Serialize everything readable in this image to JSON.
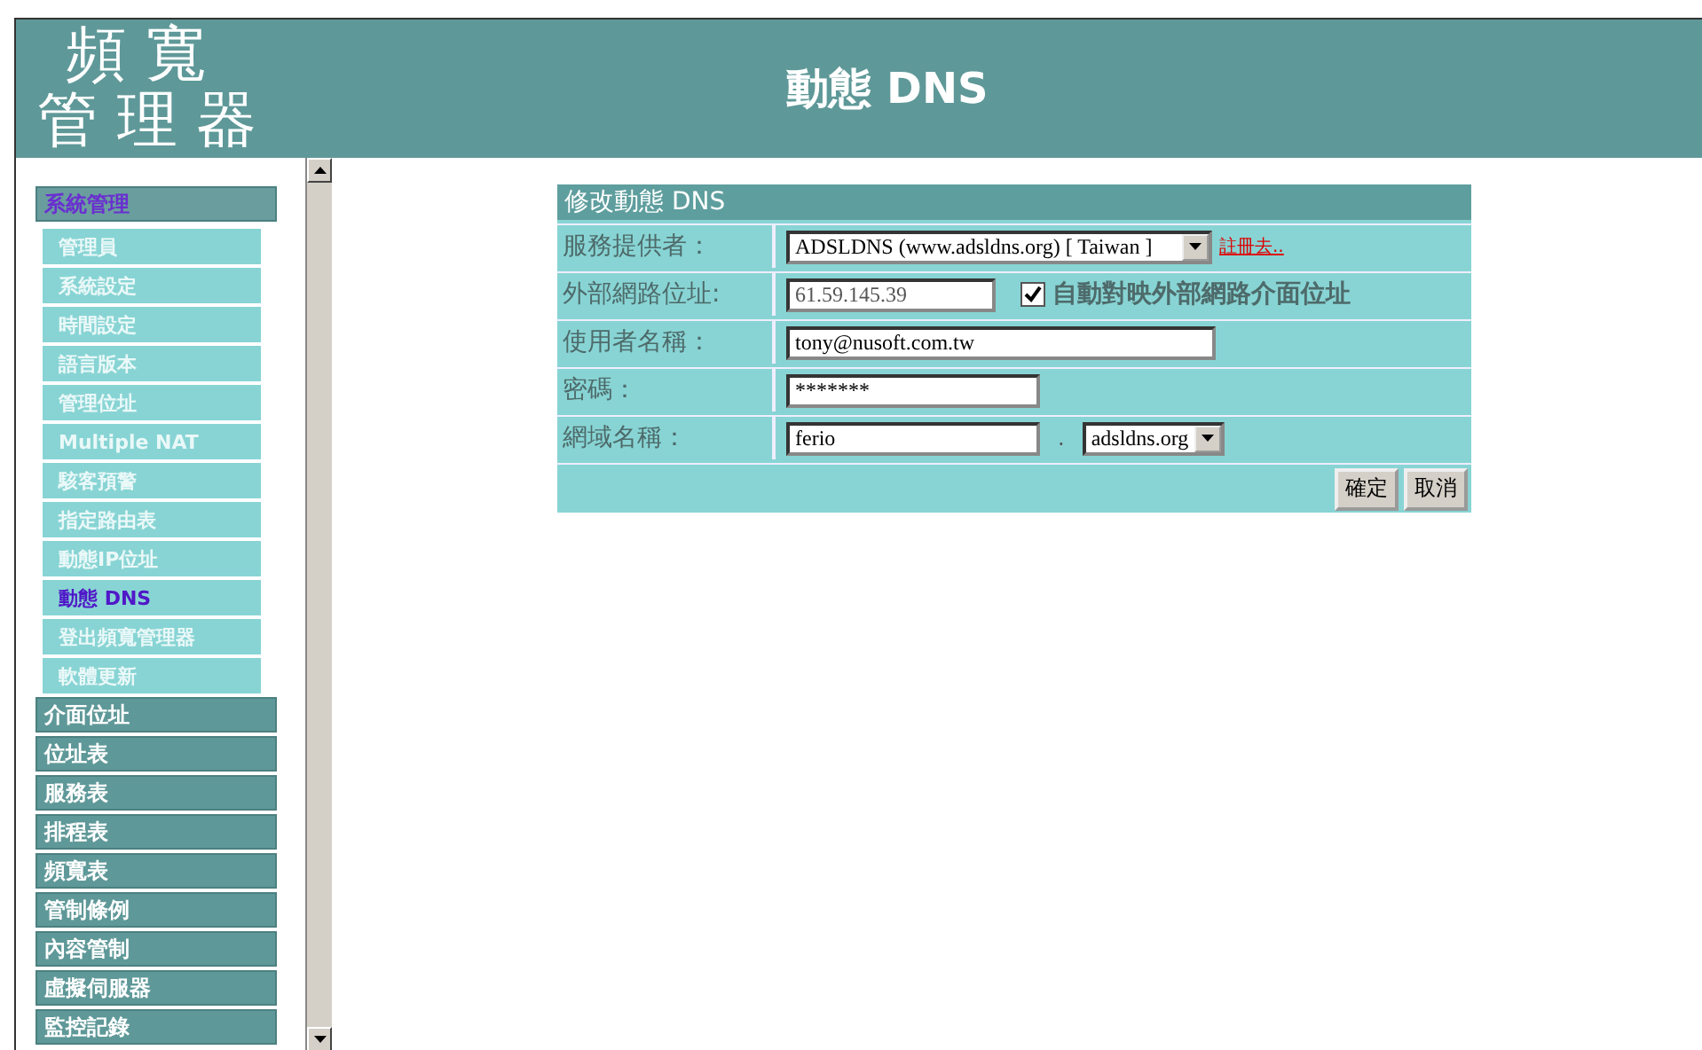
{
  "header": {
    "logo_lines": [
      "頻 寬",
      "管 理 器"
    ],
    "title": "動態 DNS"
  },
  "sidebar": {
    "groups": [
      {
        "label": "系統管理",
        "expanded": true,
        "children": [
          {
            "label": "管理員",
            "selected": false
          },
          {
            "label": "系統設定",
            "selected": false
          },
          {
            "label": "時間設定",
            "selected": false
          },
          {
            "label": "語言版本",
            "selected": false
          },
          {
            "label": "管理位址",
            "selected": false
          },
          {
            "label": "Multiple NAT",
            "selected": false
          },
          {
            "label": "駭客預警",
            "selected": false
          },
          {
            "label": "指定路由表",
            "selected": false
          },
          {
            "label": "動態IP位址",
            "selected": false
          },
          {
            "label": "動態 DNS",
            "selected": true
          },
          {
            "label": "登出頻寬管理器",
            "selected": false
          },
          {
            "label": "軟體更新",
            "selected": false
          }
        ]
      },
      {
        "label": "介面位址",
        "expanded": false
      },
      {
        "label": "位址表",
        "expanded": false
      },
      {
        "label": "服務表",
        "expanded": false
      },
      {
        "label": "排程表",
        "expanded": false
      },
      {
        "label": "頻寬表",
        "expanded": false
      },
      {
        "label": "管制條例",
        "expanded": false
      },
      {
        "label": "內容管制",
        "expanded": false
      },
      {
        "label": "虛擬伺服器",
        "expanded": false
      },
      {
        "label": "監控記錄",
        "expanded": false
      }
    ]
  },
  "form": {
    "title": "修改動態 DNS",
    "rows": [
      {
        "kind": "select",
        "label": "服務提供者：",
        "value": "ADSLDNS (www.adsldns.org) [ Taiwan ]",
        "link": "註冊去.."
      },
      {
        "kind": "ip",
        "label": "外部網路位址:",
        "value": "61.59.145.39",
        "disabled": true,
        "checkbox": {
          "label": "自動對映外部網路介面位址",
          "checked": true
        }
      },
      {
        "kind": "text",
        "label": "使用者名稱：",
        "value": "tony@nusoft.com.tw"
      },
      {
        "kind": "password",
        "label": "密碼：",
        "value": "*******"
      },
      {
        "kind": "domain",
        "label": "網域名稱：",
        "value": "ferio",
        "separator": ".",
        "suffix": "adsldns.org"
      }
    ],
    "buttons": [
      "確定",
      "取消"
    ]
  }
}
